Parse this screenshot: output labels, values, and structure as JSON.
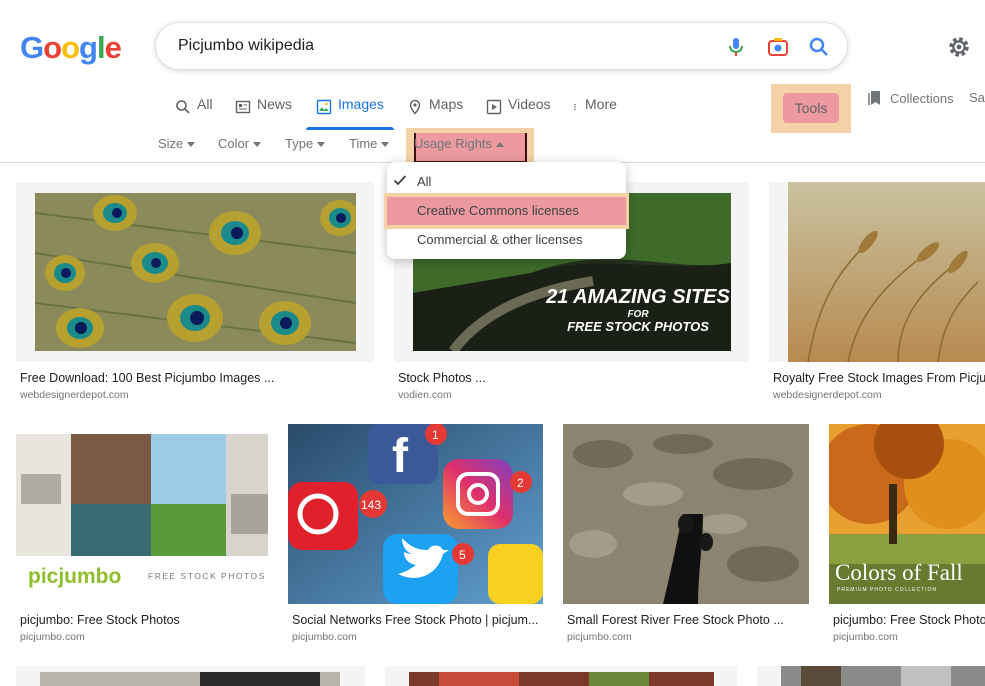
{
  "logo": {
    "letters": [
      "G",
      "o",
      "o",
      "g",
      "l",
      "e"
    ],
    "colors": [
      "#4285F4",
      "#EA4335",
      "#FBBC05",
      "#4285F4",
      "#34A853",
      "#EA4335"
    ]
  },
  "search": {
    "query": "Picjumbo wikipedia"
  },
  "tabs": [
    {
      "label": "All",
      "icon": "search-icon"
    },
    {
      "label": "News",
      "icon": "news-icon"
    },
    {
      "label": "Images",
      "icon": "image-icon",
      "active": true
    },
    {
      "label": "Maps",
      "icon": "map-pin-icon"
    },
    {
      "label": "Videos",
      "icon": "play-icon"
    },
    {
      "label": "More",
      "icon": "more-vert-icon"
    }
  ],
  "tools": {
    "label": "Tools"
  },
  "collections": {
    "label": "Collections",
    "saved_cut": "Sa"
  },
  "filters": {
    "size": "Size",
    "color": "Color",
    "type": "Type",
    "time": "Time",
    "usage": "Usage Rights"
  },
  "usage_dropdown": {
    "options": [
      "All",
      "Creative Commons licenses",
      "Commercial & other licenses"
    ],
    "selected": "All"
  },
  "results_row1": [
    {
      "title": "Free Download: 100 Best Picjumbo Images ...",
      "source": "webdesignerdepot.com"
    },
    {
      "title": "Stock Photos ...",
      "source": "vodien.com",
      "overlay": [
        "21 AMAZING SITES",
        "FOR",
        "FREE STOCK PHOTOS"
      ]
    },
    {
      "title": "Royalty Free Stock Images From Picjum",
      "source": "webdesignerdepot.com"
    }
  ],
  "results_row2": [
    {
      "title": "picjumbo: Free Stock Photos",
      "source": "picjumbo.com",
      "overlay": [
        "picjumbo",
        "FREE STOCK PHOTOS"
      ]
    },
    {
      "title": "Social Networks Free Stock Photo | picjum...",
      "source": "picjumbo.com"
    },
    {
      "title": "Small Forest River Free Stock Photo ...",
      "source": "picjumbo.com"
    },
    {
      "title": "picjumbo: Free Stock Photo",
      "source": "picjumbo.com",
      "overlay": [
        "Colors of Fall",
        "PREMIUM PHOTO COLLECTION"
      ]
    }
  ],
  "colors": {
    "accent": "#1a73e8",
    "highlight_outer": "#f6d1a8",
    "highlight_inner": "#ec9aa0"
  }
}
